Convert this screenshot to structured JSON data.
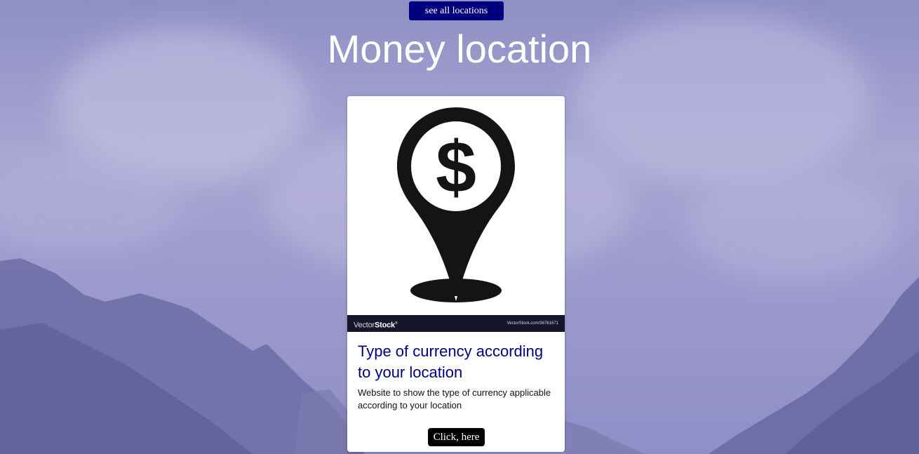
{
  "header": {
    "see_all_label": "see all locations",
    "title": "Money location"
  },
  "card": {
    "image": {
      "icon": "money-location-pin-icon",
      "watermark_brand_light": "Vector",
      "watermark_brand_bold": "Stock",
      "watermark_trademark": "®",
      "watermark_ref": "VectorStock.com/36761671"
    },
    "title": "Type of currency according to your location",
    "description": "Website to show the type of currency applicable according to your location",
    "button_label": "Click, here"
  },
  "colors": {
    "primary_button": "#00007f",
    "card_title": "#00007f",
    "card_button": "#000000",
    "background_tint": "#a9a6d2"
  }
}
